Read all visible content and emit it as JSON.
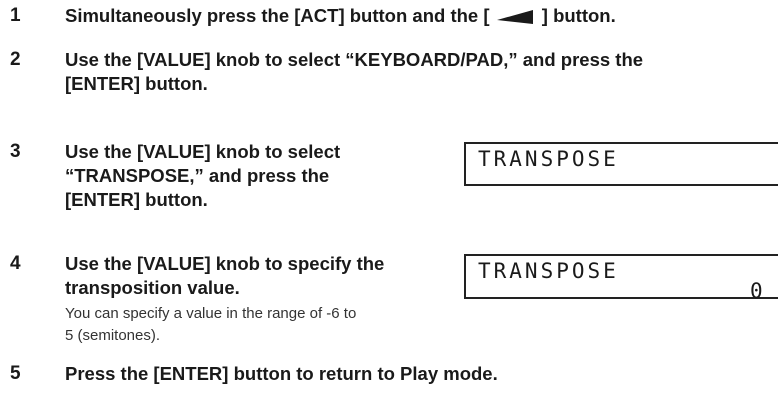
{
  "steps": [
    {
      "number": "1",
      "text_before": "Simultaneously press the [ACT] button and the [",
      "text_after": "] button."
    },
    {
      "number": "2",
      "line1": "Use the [VALUE] knob to select “KEYBOARD/PAD,” and press the",
      "line2": "[ENTER] button."
    },
    {
      "number": "3",
      "line1": "Use the [VALUE] knob to select",
      "line2": "“TRANSPOSE,” and press the",
      "line3": "[ENTER] button.",
      "display": {
        "text": "TRANSPOSE"
      }
    },
    {
      "number": "4",
      "line1": "Use the [VALUE] knob to specify the",
      "line2": "transposition value.",
      "note_line1": "You can specify a value in the range of -6 to",
      "note_line2": "5 (semitones).",
      "display": {
        "text": "TRANSPOSE",
        "value": "0"
      }
    },
    {
      "number": "5",
      "line1": "Press the [ENTER] button to return to Play mode."
    }
  ],
  "icons": {
    "left_arrow": "left-arrow-icon"
  }
}
